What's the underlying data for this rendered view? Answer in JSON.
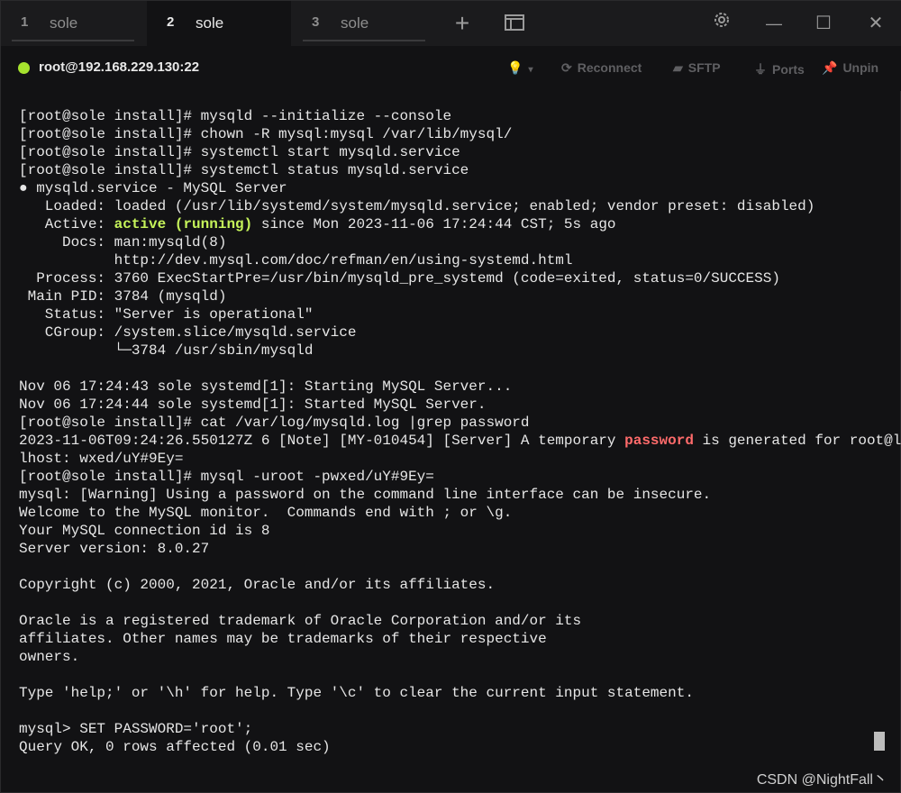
{
  "tabs": [
    {
      "num": "1",
      "label": "sole"
    },
    {
      "num": "2",
      "label": "sole"
    },
    {
      "num": "3",
      "label": "sole"
    }
  ],
  "icons": {
    "new_tab": "+",
    "tab_overview": "▢",
    "settings": "⚙",
    "minimize": "—",
    "maximize": "☐",
    "close": "✕"
  },
  "session": {
    "host": "root@192.168.229.130:22",
    "status_color": "#a6e22e",
    "actions": {
      "bulb": "💡",
      "reconnect": "Reconnect",
      "sftp": "SFTP",
      "ports": "Ports",
      "unpin": "Unpin"
    }
  },
  "terminal": {
    "lines": [
      "[root@sole install]# mysqld --initialize --console",
      "[root@sole install]# chown -R mysql:mysql /var/lib/mysql/",
      "[root@sole install]# systemctl start mysqld.service",
      "[root@sole install]# systemctl status mysqld.service",
      "● mysqld.service - MySQL Server",
      "   Loaded: loaded (/usr/lib/systemd/system/mysqld.service; enabled; vendor preset: disabled)",
      {
        "pre": "   Active: ",
        "hl": "active (running)",
        "post": " since Mon 2023-11-06 17:24:44 CST; 5s ago",
        "cls": "hl-green"
      },
      "     Docs: man:mysqld(8)",
      "           http://dev.mysql.com/doc/refman/en/using-systemd.html",
      "  Process: 3760 ExecStartPre=/usr/bin/mysqld_pre_systemd (code=exited, status=0/SUCCESS)",
      " Main PID: 3784 (mysqld)",
      "   Status: \"Server is operational\"",
      "   CGroup: /system.slice/mysqld.service",
      "           └─3784 /usr/sbin/mysqld",
      "",
      "Nov 06 17:24:43 sole systemd[1]: Starting MySQL Server...",
      "Nov 06 17:24:44 sole systemd[1]: Started MySQL Server.",
      "[root@sole install]# cat /var/log/mysqld.log |grep password",
      {
        "pre": "2023-11-06T09:24:26.550127Z 6 [Note] [MY-010454] [Server] A temporary ",
        "hl": "password",
        "post": " is generated for root@loca",
        "cls": "hl-red"
      },
      "lhost: wxed/uY#9Ey=",
      "[root@sole install]# mysql -uroot -pwxed/uY#9Ey=",
      "mysql: [Warning] Using a password on the command line interface can be insecure.",
      "Welcome to the MySQL monitor.  Commands end with ; or \\g.",
      "Your MySQL connection id is 8",
      "Server version: 8.0.27",
      "",
      "Copyright (c) 2000, 2021, Oracle and/or its affiliates.",
      "",
      "Oracle is a registered trademark of Oracle Corporation and/or its",
      "affiliates. Other names may be trademarks of their respective",
      "owners.",
      "",
      "Type 'help;' or '\\h' for help. Type '\\c' to clear the current input statement.",
      "",
      "mysql> SET PASSWORD='root';",
      "Query OK, 0 rows affected (0.01 sec)"
    ]
  },
  "watermark": "CSDN @NightFall丶"
}
